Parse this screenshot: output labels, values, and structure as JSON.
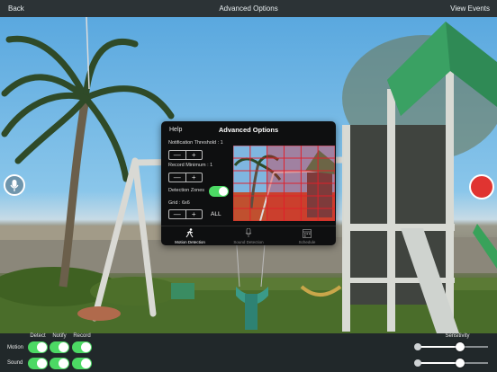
{
  "nav": {
    "back_label": "Back",
    "title": "Advanced Options",
    "view_events_label": "View Events"
  },
  "overlay": {
    "title": "Advanced Options",
    "help_label": "Help",
    "notification_threshold_label": "Notification Threshold : 1",
    "record_minimum_label": "Record Minimum : 1",
    "detection_zones_label": "Detection Zones",
    "detection_zones_on": true,
    "grid_label": "Grid : 6x6",
    "all_label": "ALL",
    "minus_symbol": "—",
    "plus_symbol": "+",
    "tabs": [
      {
        "label": "Motion Detection",
        "icon": "running-person-icon",
        "active": true
      },
      {
        "label": "Sound Detection",
        "icon": "microphone-icon",
        "active": false
      },
      {
        "label": "Schedule",
        "icon": "calendar-icon",
        "active": false
      }
    ]
  },
  "side_controls": {
    "left_icon": "microphone-icon",
    "right_icon": "record-icon",
    "record_color": "#e03431"
  },
  "bottom": {
    "columns": [
      "Detect",
      "Notify",
      "Record"
    ],
    "rows": [
      {
        "label": "Motion",
        "detect": true,
        "notify": true,
        "record": true
      },
      {
        "label": "Sound",
        "detect": true,
        "notify": true,
        "record": true
      }
    ],
    "sensitivity_label": "Sensitivity",
    "motion_sensitivity": 0.6,
    "sound_sensitivity": 0.6
  },
  "colors": {
    "toggle_on": "#4cd964",
    "grid_zone": "#e0202a",
    "topbar": "#2c3336"
  }
}
